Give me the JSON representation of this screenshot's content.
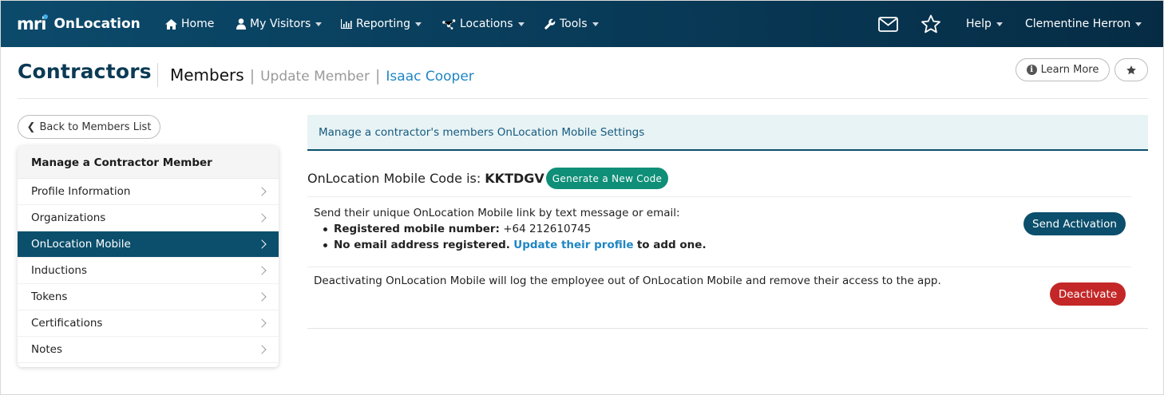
{
  "nav": {
    "brand_logo": "mri",
    "brand_name": "OnLocation",
    "items": [
      {
        "label": "Home",
        "icon": "home-icon"
      },
      {
        "label": "My Visitors",
        "icon": "person-icon"
      },
      {
        "label": "Reporting",
        "icon": "bar-chart-icon"
      },
      {
        "label": "Locations",
        "icon": "nodes-icon"
      },
      {
        "label": "Tools",
        "icon": "wrench-icon"
      }
    ],
    "help_label": "Help",
    "user_name": "Clementine Herron"
  },
  "header": {
    "title": "Contractors",
    "breadcrumb": [
      "Members",
      "Update Member",
      "Isaac Cooper"
    ],
    "learn_more_label": "Learn More"
  },
  "sidebar": {
    "back_label": "Back to Members List",
    "heading": "Manage a Contractor Member",
    "items": [
      {
        "label": "Profile Information",
        "active": false
      },
      {
        "label": "Organizations",
        "active": false
      },
      {
        "label": "OnLocation Mobile",
        "active": true
      },
      {
        "label": "Inductions",
        "active": false
      },
      {
        "label": "Tokens",
        "active": false
      },
      {
        "label": "Certifications",
        "active": false
      },
      {
        "label": "Notes",
        "active": false
      }
    ]
  },
  "main": {
    "banner": "Manage a contractor's members OnLocation Mobile Settings",
    "code_label": "OnLocation Mobile Code is:",
    "code_value": "KKTDGV",
    "generate_label": "Generate a New Code",
    "send_intro": "Send their unique OnLocation Mobile link by text message or email:",
    "mobile_label": "Registered mobile number:",
    "mobile_value": "+64 212610745",
    "email_label": "No email address registered.",
    "email_link": "Update their profile",
    "email_suffix": "to add one.",
    "send_button": "Send Activation",
    "deactivate_text": "Deactivating OnLocation Mobile will log the employee out of OnLocation Mobile and remove their access to the app.",
    "deactivate_button": "Deactivate"
  },
  "colors": {
    "nav_bg": "#0c4a6b",
    "primary": "#0b4f6c",
    "success": "#0f8f78",
    "danger": "#c42727",
    "link": "#1f86c4"
  }
}
